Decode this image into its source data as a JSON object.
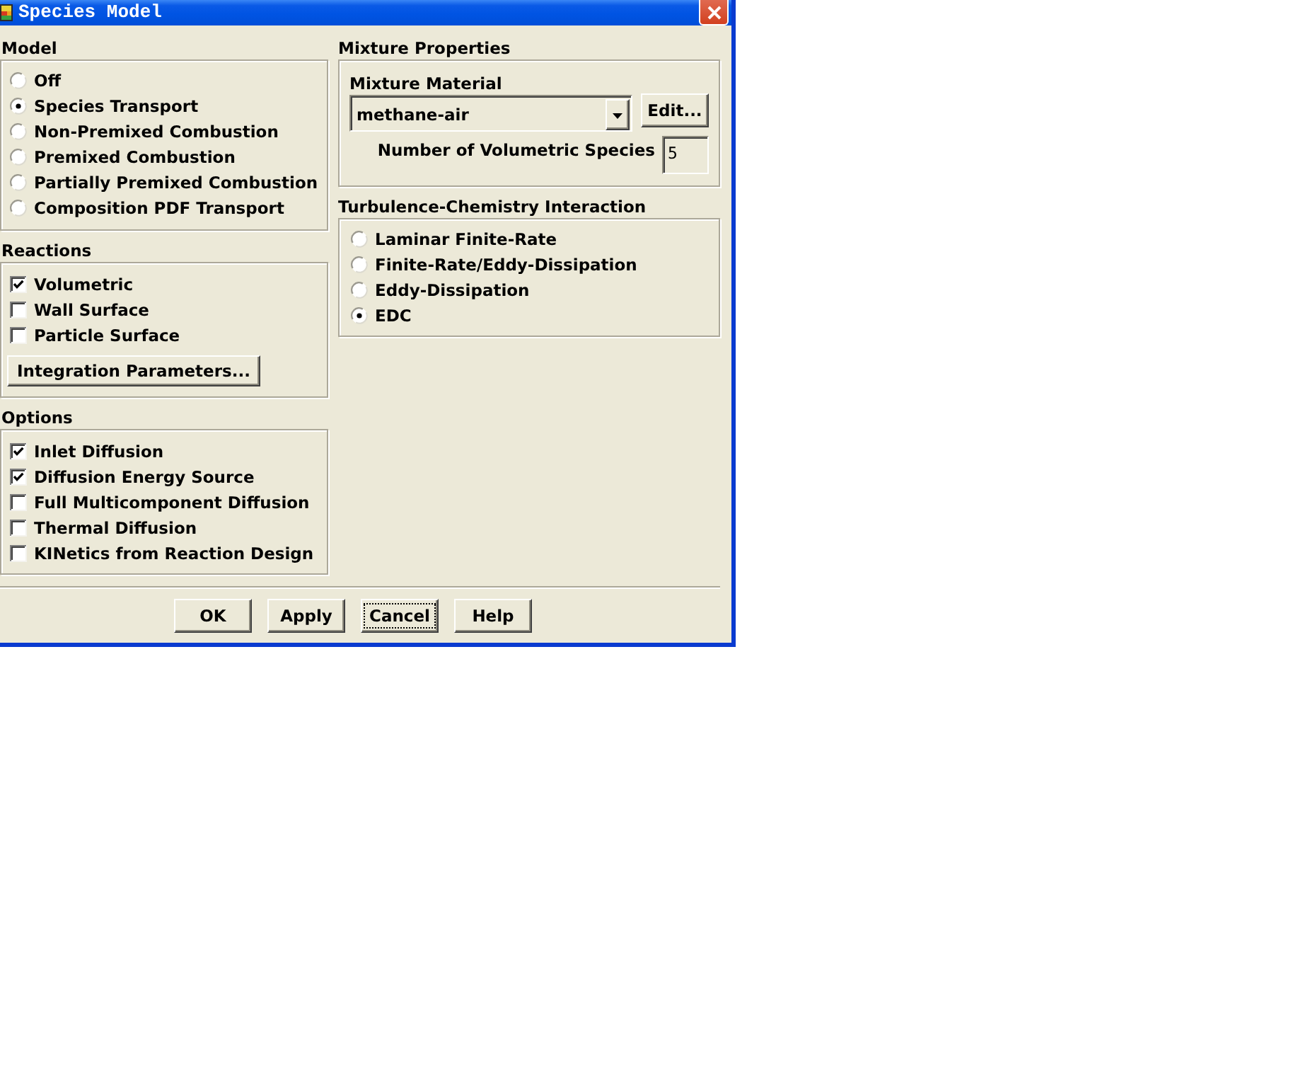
{
  "window": {
    "title": "Species Model"
  },
  "model": {
    "label": "Model",
    "options": [
      {
        "label": "Off",
        "selected": false
      },
      {
        "label": "Species Transport",
        "selected": true
      },
      {
        "label": "Non-Premixed Combustion",
        "selected": false
      },
      {
        "label": "Premixed Combustion",
        "selected": false
      },
      {
        "label": "Partially Premixed Combustion",
        "selected": false
      },
      {
        "label": "Composition PDF Transport",
        "selected": false
      }
    ]
  },
  "reactions": {
    "label": "Reactions",
    "options": [
      {
        "label": "Volumetric",
        "checked": true
      },
      {
        "label": "Wall Surface",
        "checked": false
      },
      {
        "label": "Particle Surface",
        "checked": false
      }
    ],
    "button": "Integration Parameters..."
  },
  "options": {
    "label": "Options",
    "options": [
      {
        "label": "Inlet Diffusion",
        "checked": true
      },
      {
        "label": "Diffusion Energy Source",
        "checked": true
      },
      {
        "label": "Full Multicomponent Diffusion",
        "checked": false
      },
      {
        "label": "Thermal Diffusion",
        "checked": false
      },
      {
        "label": "KINetics from Reaction Design",
        "checked": false
      }
    ]
  },
  "mixture_properties": {
    "label": "Mixture Properties",
    "mixture_material": {
      "label": "Mixture Material",
      "value": "methane-air",
      "button": "Edit..."
    },
    "volumetric_species": {
      "label": "Number of Volumetric Species",
      "value": "5"
    }
  },
  "turbulence_chemistry_interaction": {
    "label": "Turbulence-Chemistry Interaction",
    "options": [
      {
        "label": "Laminar Finite-Rate",
        "selected": false
      },
      {
        "label": "Finite-Rate/Eddy-Dissipation",
        "selected": false
      },
      {
        "label": "Eddy-Dissipation",
        "selected": false
      },
      {
        "label": "EDC",
        "selected": true
      }
    ]
  },
  "buttons": [
    {
      "label": "OK",
      "focused": false
    },
    {
      "label": "Apply",
      "focused": false
    },
    {
      "label": "Cancel",
      "focused": true
    },
    {
      "label": "Help",
      "focused": false
    }
  ]
}
